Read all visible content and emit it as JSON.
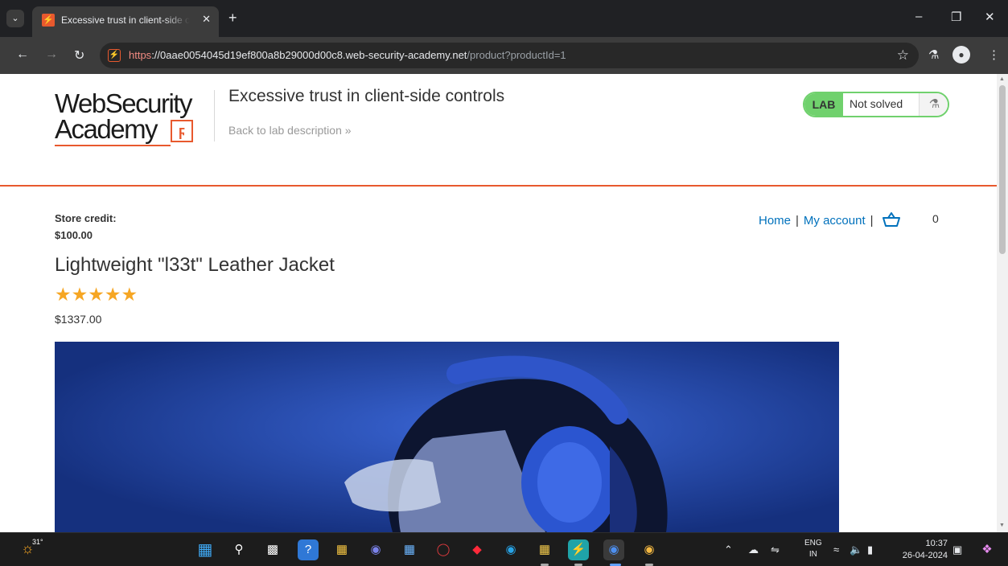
{
  "browser": {
    "tab_title": "Excessive trust in client-side co",
    "url_scheme": "https",
    "url_host": "://0aae0054045d19ef800a8b29000d00c8.web-security-academy.net",
    "url_path": "/product?productId=1"
  },
  "header": {
    "logo_line1": "WebSecurity",
    "logo_line2": "Academy",
    "lab_title": "Excessive trust in client-side controls",
    "back_link": "Back to lab description »",
    "lab_badge": "LAB",
    "lab_status": "Not solved"
  },
  "store": {
    "credit_label": "Store credit:",
    "credit_value": "$100.00"
  },
  "nav": {
    "home": "Home",
    "my_account": "My account",
    "separator": "|",
    "cart_count": "0"
  },
  "product": {
    "title": "Lightweight \"l33t\" Leather Jacket",
    "rating_stars": 5,
    "price": "$1337.00"
  },
  "taskbar": {
    "weather_temp": "31°",
    "lang_line1": "ENG",
    "lang_line2": "IN",
    "time": "10:37",
    "date": "26-04-2024"
  },
  "colors": {
    "brand_orange": "#e8592e",
    "lab_green": "#70d16d",
    "link_blue": "#0071bc",
    "star_gold": "#f6a623"
  }
}
